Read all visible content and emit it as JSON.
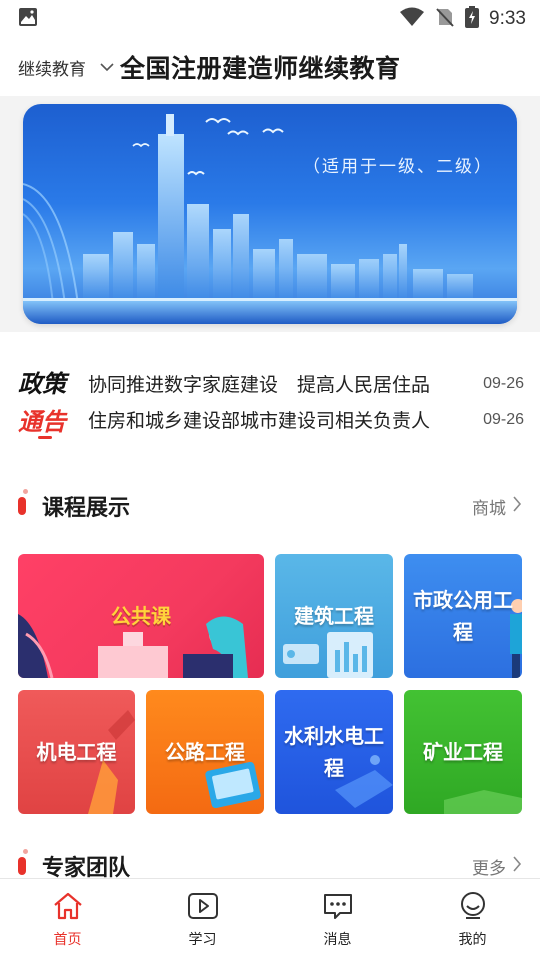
{
  "status_bar": {
    "time": "9:33"
  },
  "header": {
    "scope_label": "继续教育",
    "title": "全国注册建造师继续教育"
  },
  "banner": {
    "subtitle": "（适用于一级、二级）"
  },
  "notice": {
    "logo_top": "政策",
    "logo_bottom": "通告",
    "items": [
      {
        "text": "协同推进数字家庭建设　提高人民居住品",
        "date": "09-26"
      },
      {
        "text": "住房和城乡建设部城市建设司相关负责人",
        "date": "09-26"
      }
    ]
  },
  "courses_section": {
    "title": "课程展示",
    "more_label": "商城",
    "items": [
      {
        "label": "公共课"
      },
      {
        "label": "建筑工程"
      },
      {
        "label": "市政公用工程"
      },
      {
        "label": "机电工程"
      },
      {
        "label": "公路工程"
      },
      {
        "label": "水利水电工程"
      },
      {
        "label": "矿业工程"
      }
    ]
  },
  "experts_section": {
    "title": "专家团队",
    "more_label": "更多"
  },
  "tabbar": {
    "tabs": [
      {
        "label": "首页",
        "icon": "home-icon",
        "active": true
      },
      {
        "label": "学习",
        "icon": "play-icon",
        "active": false
      },
      {
        "label": "消息",
        "icon": "message-icon",
        "active": false
      },
      {
        "label": "我的",
        "icon": "profile-icon",
        "active": false
      }
    ]
  },
  "colors": {
    "accent": "#e8322b"
  }
}
